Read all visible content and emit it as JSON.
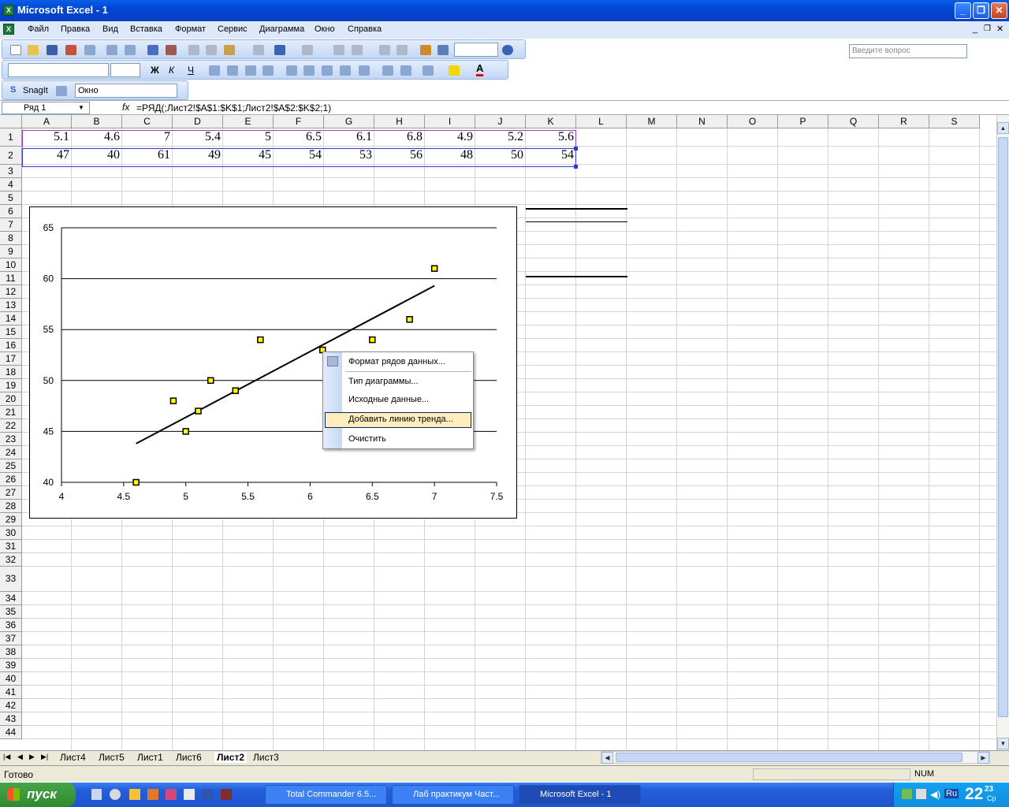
{
  "window": {
    "title": "Microsoft Excel - 1"
  },
  "menu": [
    "Файл",
    "Правка",
    "Вид",
    "Вставка",
    "Формат",
    "Сервис",
    "Диаграмма",
    "Окно",
    "Справка"
  ],
  "help_placeholder": "Введите вопрос",
  "snagit": {
    "label": "SnagIt",
    "combo": "Окно"
  },
  "formula_bar": {
    "name_box": "Ряд 1",
    "fx": "fx",
    "formula": "=РЯД(;Лист2!$A$1:$K$1;Лист2!$A$2:$K$2;1)"
  },
  "columns": [
    "A",
    "B",
    "C",
    "D",
    "E",
    "F",
    "G",
    "H",
    "I",
    "J",
    "K",
    "L",
    "M",
    "N",
    "O",
    "P",
    "Q",
    "R",
    "S"
  ],
  "rows": [
    "1",
    "2",
    "3",
    "4",
    "5",
    "6",
    "7",
    "8",
    "9",
    "10",
    "11",
    "12",
    "13",
    "14",
    "15",
    "16",
    "17",
    "18",
    "19",
    "20",
    "21",
    "22",
    "23",
    "24",
    "25",
    "26",
    "27",
    "28",
    "29",
    "30",
    "31",
    "32",
    "33",
    "34",
    "35",
    "36",
    "37",
    "38",
    "39",
    "40",
    "41",
    "42",
    "43",
    "44"
  ],
  "cells": {
    "row1": [
      "5.1",
      "4.6",
      "7",
      "5.4",
      "5",
      "6.5",
      "6.1",
      "6.8",
      "4.9",
      "5.2",
      "5.6"
    ],
    "row2": [
      "47",
      "40",
      "61",
      "49",
      "45",
      "54",
      "53",
      "56",
      "48",
      "50",
      "54"
    ]
  },
  "chart_data": {
    "type": "scatter",
    "title": "",
    "xlabel": "",
    "ylabel": "",
    "xlim": [
      4,
      7.5
    ],
    "ylim": [
      40,
      65
    ],
    "x_ticks": [
      "4",
      "4.5",
      "5",
      "5.5",
      "6",
      "6.5",
      "7",
      "7.5"
    ],
    "y_ticks": [
      "40",
      "45",
      "50",
      "55",
      "60",
      "65"
    ],
    "grid": "horizontal",
    "series": [
      {
        "x": [
          5.1,
          4.6,
          7,
          5.4,
          5,
          6.5,
          6.1,
          6.8,
          4.9,
          5.2,
          5.6
        ],
        "y": [
          47,
          40,
          61,
          49,
          45,
          54,
          53,
          56,
          48,
          50,
          54
        ]
      }
    ],
    "trendline": {
      "x": [
        4.6,
        7
      ],
      "y": [
        43.8,
        59.3
      ]
    }
  },
  "context_menu": {
    "items": [
      "Формат рядов данных...",
      "Тип диаграммы...",
      "Исходные данные...",
      "Добавить линию тренда...",
      "Очистить"
    ],
    "highlighted": "Добавить линию тренда..."
  },
  "sheet_tabs": [
    "Лист4",
    "Лист5",
    "Лист1",
    "Лист6",
    "Лист2",
    "Лист3"
  ],
  "active_sheet": "Лист2",
  "status": {
    "left": "Готово",
    "num": "NUM"
  },
  "taskbar": {
    "start": "пуск",
    "tasks": [
      "Total Commander 6.5...",
      "Лаб практикум Част...",
      "Microsoft Excel - 1"
    ],
    "lang": "Ru",
    "clock": "22",
    "clock_small": "23",
    "clock_day": "Ср"
  }
}
